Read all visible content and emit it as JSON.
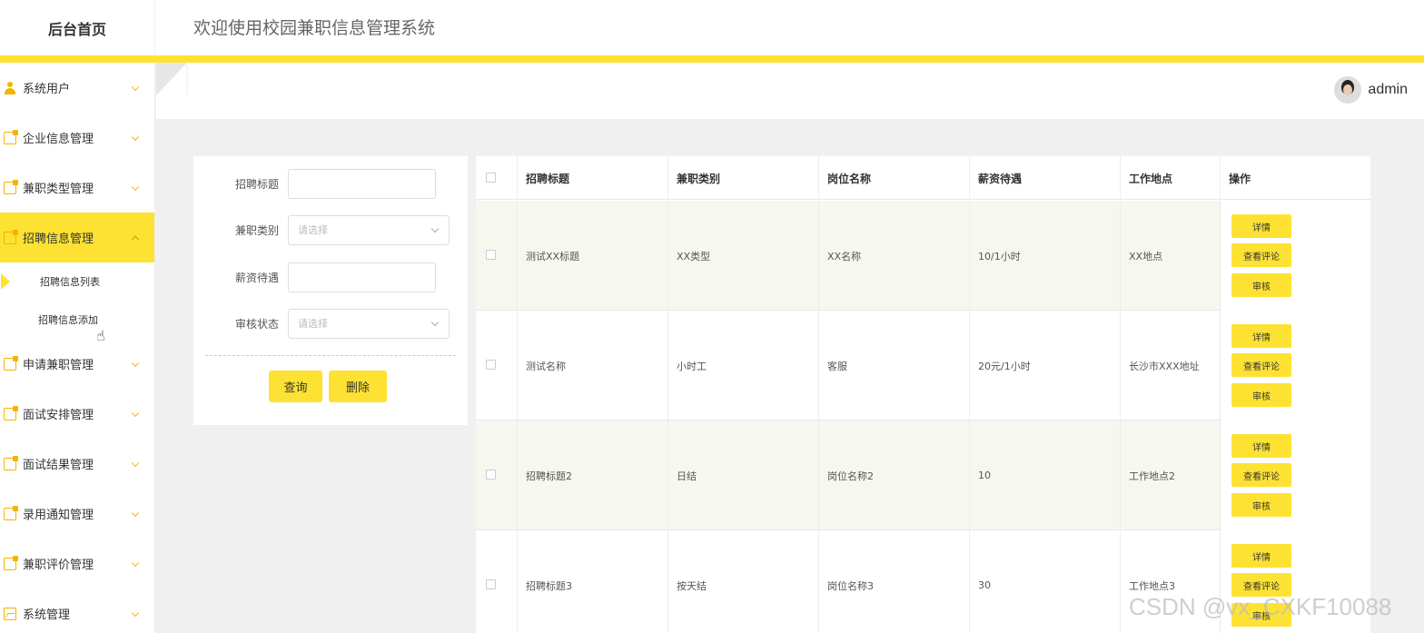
{
  "header": {
    "brand": "后台首页",
    "welcome": "欢迎使用校园兼职信息管理系统"
  },
  "sidebar": {
    "items": [
      {
        "label": "系统用户",
        "icon": "user-icon"
      },
      {
        "label": "企业信息管理",
        "icon": "folder-icon"
      },
      {
        "label": "兼职类型管理",
        "icon": "folder-icon"
      },
      {
        "label": "招聘信息管理",
        "icon": "folder-icon",
        "active": true
      },
      {
        "label": "申请兼职管理",
        "icon": "folder-icon"
      },
      {
        "label": "面试安排管理",
        "icon": "folder-icon"
      },
      {
        "label": "面试结果管理",
        "icon": "folder-icon"
      },
      {
        "label": "录用通知管理",
        "icon": "folder-icon"
      },
      {
        "label": "兼职评价管理",
        "icon": "folder-icon"
      },
      {
        "label": "系统管理",
        "icon": "image-icon"
      }
    ],
    "submenu": [
      {
        "label": "招聘信息列表",
        "current": true
      },
      {
        "label": "招聘信息添加"
      }
    ]
  },
  "user": {
    "name": "admin"
  },
  "search": {
    "fields": [
      {
        "label": "招聘标题",
        "type": "input",
        "value": ""
      },
      {
        "label": "兼职类别",
        "type": "select",
        "placeholder": "请选择"
      },
      {
        "label": "薪资待遇",
        "type": "input",
        "value": ""
      },
      {
        "label": "审核状态",
        "type": "select",
        "placeholder": "请选择"
      }
    ],
    "query_label": "查询",
    "delete_label": "删除"
  },
  "table": {
    "columns": [
      "招聘标题",
      "兼职类别",
      "岗位名称",
      "薪资待遇",
      "工作地点",
      "操作"
    ],
    "rows": [
      [
        "测试XX标题",
        "XX类型",
        "XX名称",
        "10/1小时",
        "XX地点"
      ],
      [
        "测试名称",
        "小时工",
        "客服",
        "20元/1小时",
        "长沙市XXX地址"
      ],
      [
        "招聘标题2",
        "日结",
        "岗位名称2",
        "10",
        "工作地点2"
      ],
      [
        "招聘标题3",
        "按天结",
        "岗位名称3",
        "30",
        "工作地点3"
      ]
    ],
    "actions": [
      "详情",
      "查看评论",
      "审核"
    ]
  },
  "watermark": "CSDN @vx_CXKF10088",
  "colors": {
    "accent": "#fde233",
    "icon": "#f4b400"
  }
}
